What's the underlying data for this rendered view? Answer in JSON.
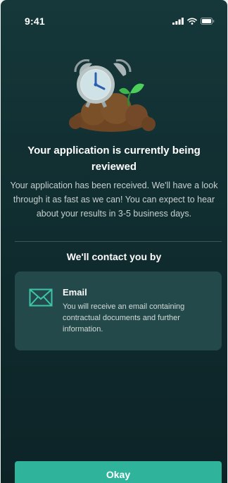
{
  "status_bar": {
    "time": "9:41",
    "icons": [
      "signal-icon",
      "wifi-icon",
      "battery-icon"
    ]
  },
  "illustration": {
    "icon": "alarm-clock-with-sprout-illustration"
  },
  "header": {
    "title": "Your application is currently being reviewed",
    "message": "Your application has been received. We'll have a look through it as fast as we can! You can expect to hear about your results in 3-5 business days."
  },
  "contact": {
    "heading": "We'll contact you by",
    "methods": [
      {
        "icon": "envelope-icon",
        "label": "Email",
        "description": "You will receive an email containing contractual documents and further information."
      }
    ]
  },
  "actions": {
    "okay_label": "Okay"
  },
  "colors": {
    "background_top": "#16383a",
    "background_bottom": "#0d2427",
    "card": "#24494a",
    "accent": "#2fb39b"
  }
}
